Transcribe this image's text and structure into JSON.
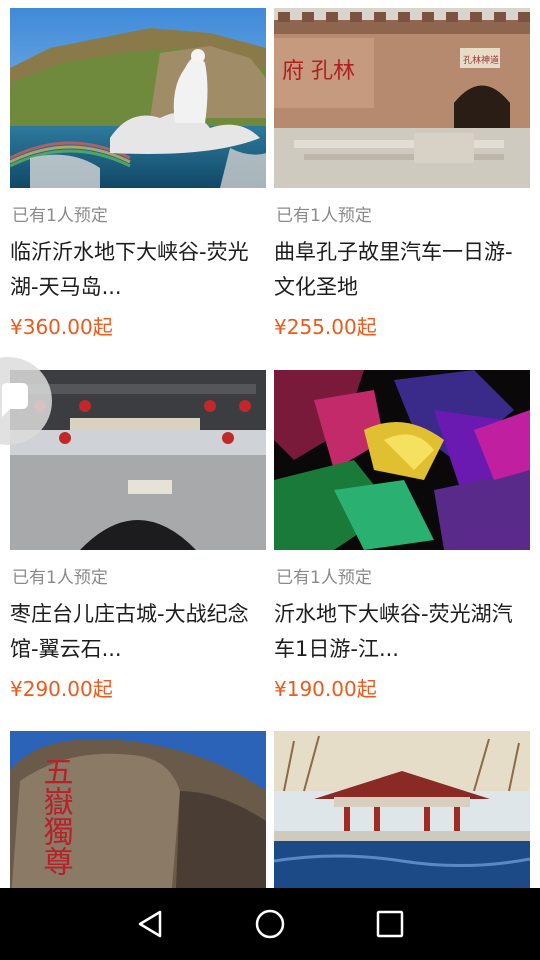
{
  "products": [
    {
      "bookings": "已有1人预定",
      "title": "临沂沂水地下大峡谷-荧光湖-天马岛...",
      "price": "¥360.00起",
      "image": "goddess-statue-lotus-fountain"
    },
    {
      "bookings": "已有1人预定",
      "title": "曲阜孔子故里汽车一日游-文化圣地",
      "price": "¥255.00起",
      "image": "confucius-mansion-wall-gate"
    },
    {
      "bookings": "已有1人预定",
      "title": "枣庄台儿庄古城-大战纪念馆-翼云石...",
      "price": "¥290.00起",
      "image": "taierzhuang-city-gate"
    },
    {
      "bookings": "已有1人预定",
      "title": "沂水地下大峡谷-荧光湖汽车1日游-江...",
      "price": "¥190.00起",
      "image": "colorful-lit-cave"
    },
    {
      "bookings": "",
      "title": "",
      "price": "",
      "image": "mount-tai-carved-rock"
    },
    {
      "bookings": "",
      "title": "",
      "price": "",
      "image": "lakeside-pavilion"
    }
  ],
  "thumbnail_text": {
    "confucius_wall": "府 孔林",
    "confucius_plaque": "孔林神道",
    "rock_carving": "五嶽獨尊"
  },
  "floating_button": {
    "icon": "chat-bubble-icon"
  },
  "nav_bar": {
    "back": "back-triangle-icon",
    "home": "home-circle-icon",
    "recents": "recents-square-icon",
    "background": "#000000"
  },
  "colors": {
    "price": "#ec5a1c",
    "muted": "#8a8a8a",
    "title": "#1d1d1d"
  }
}
